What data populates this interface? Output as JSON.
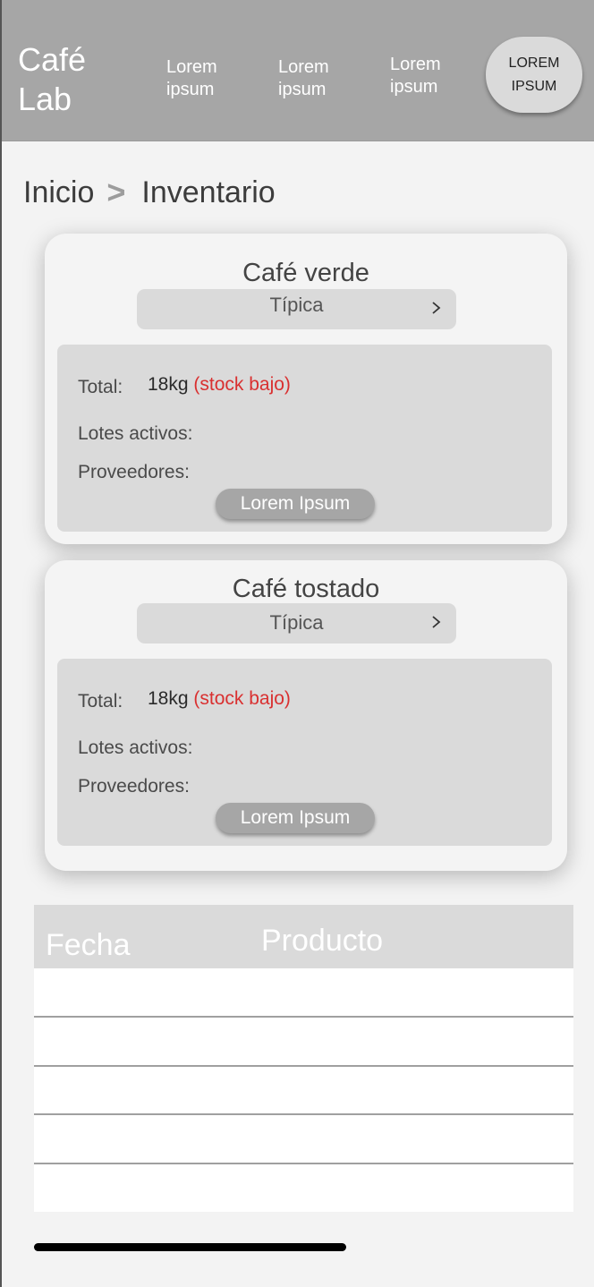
{
  "header": {
    "logo": "Café\nLab",
    "nav": [
      {
        "label": "Lorem ipsum"
      },
      {
        "label": "Lorem ipsum"
      },
      {
        "label": "Lorem ipsum"
      }
    ],
    "cta_label": "LOREM IPSUM",
    "bg_color": "#a6a6a6"
  },
  "breadcrumb": {
    "home": "Inicio",
    "separator": ">",
    "current": "Inventario"
  },
  "cards": [
    {
      "title": "Café verde",
      "variety": "Típica",
      "total_label": "Total:",
      "total_value": "18kg",
      "total_warning": "(stock bajo)",
      "lotes_label": "Lotes activos:",
      "proveedores_label": "Proveedores:",
      "button_label": "Lorem Ipsum"
    },
    {
      "title": "Café tostado",
      "variety": "Típica",
      "total_label": "Total:",
      "total_value": "18kg",
      "total_warning": "(stock bajo)",
      "lotes_label": "Lotes activos:",
      "proveedores_label": "Proveedores:",
      "button_label": "Lorem Ipsum"
    }
  ],
  "table": {
    "columns": [
      "Fecha",
      "Producto"
    ],
    "rows": [
      [
        "",
        ""
      ],
      [
        "",
        ""
      ],
      [
        "",
        ""
      ],
      [
        "",
        ""
      ],
      [
        "",
        ""
      ]
    ]
  },
  "colors": {
    "warning": "#d93030",
    "panel": "#dadada"
  },
  "icons": [
    "chevron-right-icon"
  ]
}
